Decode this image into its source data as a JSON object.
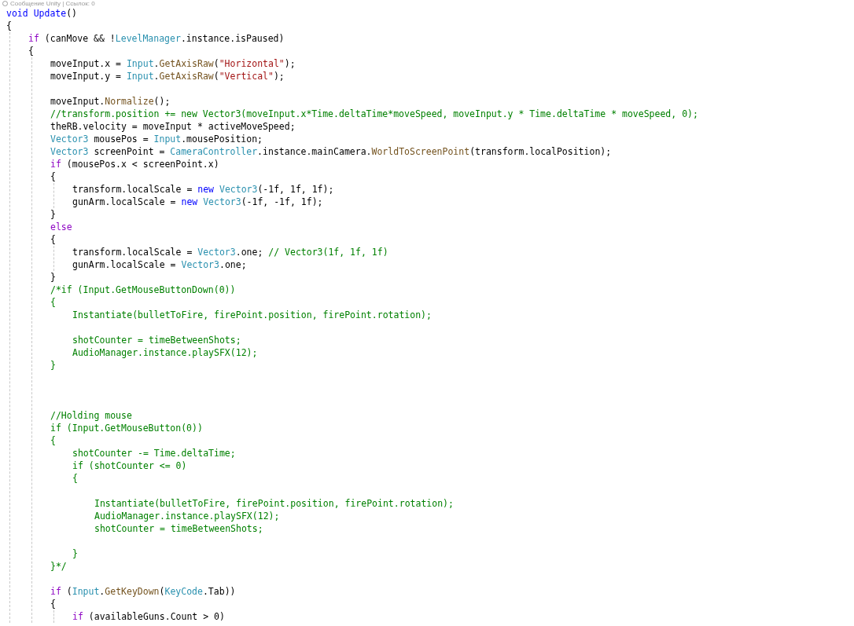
{
  "codelens": "Сообщение Unity | Ссылок: 0",
  "lines": [
    {
      "kind": "code",
      "tokens": [
        {
          "kind": "keyword",
          "text": "void "
        },
        {
          "kind": "keyword",
          "text": "Update"
        },
        {
          "kind": "plain",
          "text": "()"
        }
      ]
    },
    {
      "kind": "code",
      "tokens": [
        {
          "kind": "plain",
          "text": "{"
        }
      ],
      "children": [
        {
          "kind": "code",
          "tokens": [
            {
              "kind": "control",
              "text": "if"
            },
            {
              "kind": "plain",
              "text": " (canMove && !"
            },
            {
              "kind": "type",
              "text": "LevelManager"
            },
            {
              "kind": "plain",
              "text": ".instance.isPaused)"
            }
          ]
        },
        {
          "kind": "code",
          "tokens": [
            {
              "kind": "plain",
              "text": "{"
            }
          ],
          "children": [
            {
              "kind": "code",
              "tokens": [
                {
                  "kind": "plain",
                  "text": "moveInput.x = "
                },
                {
                  "kind": "type",
                  "text": "Input"
                },
                {
                  "kind": "plain",
                  "text": "."
                },
                {
                  "kind": "method",
                  "text": "GetAxisRaw"
                },
                {
                  "kind": "plain",
                  "text": "("
                },
                {
                  "kind": "string",
                  "text": "\"Horizontal\""
                },
                {
                  "kind": "plain",
                  "text": ");"
                }
              ]
            },
            {
              "kind": "code",
              "tokens": [
                {
                  "kind": "plain",
                  "text": "moveInput.y = "
                },
                {
                  "kind": "type",
                  "text": "Input"
                },
                {
                  "kind": "plain",
                  "text": "."
                },
                {
                  "kind": "method",
                  "text": "GetAxisRaw"
                },
                {
                  "kind": "plain",
                  "text": "("
                },
                {
                  "kind": "string",
                  "text": "\"Vertical\""
                },
                {
                  "kind": "plain",
                  "text": ");"
                }
              ]
            },
            {
              "kind": "blank"
            },
            {
              "kind": "code",
              "tokens": [
                {
                  "kind": "plain",
                  "text": "moveInput."
                },
                {
                  "kind": "method",
                  "text": "Normalize"
                },
                {
                  "kind": "plain",
                  "text": "();"
                }
              ]
            },
            {
              "kind": "code",
              "tokens": [
                {
                  "kind": "comment",
                  "text": "//transform.position += new Vector3(moveInput.x*Time.deltaTime*moveSpeed, moveInput.y * Time.deltaTime * moveSpeed, 0);"
                }
              ]
            },
            {
              "kind": "code",
              "tokens": [
                {
                  "kind": "plain",
                  "text": "theRB.velocity = moveInput * activeMoveSpeed;"
                }
              ]
            },
            {
              "kind": "code",
              "tokens": [
                {
                  "kind": "type",
                  "text": "Vector3"
                },
                {
                  "kind": "plain",
                  "text": " mousePos = "
                },
                {
                  "kind": "type",
                  "text": "Input"
                },
                {
                  "kind": "plain",
                  "text": ".mousePosition;"
                }
              ]
            },
            {
              "kind": "code",
              "tokens": [
                {
                  "kind": "type",
                  "text": "Vector3"
                },
                {
                  "kind": "plain",
                  "text": " screenPoint = "
                },
                {
                  "kind": "type",
                  "text": "CameraController"
                },
                {
                  "kind": "plain",
                  "text": ".instance.mainCamera."
                },
                {
                  "kind": "method",
                  "text": "WorldToScreenPoint"
                },
                {
                  "kind": "plain",
                  "text": "(transform.localPosition);"
                }
              ]
            },
            {
              "kind": "code",
              "tokens": [
                {
                  "kind": "control",
                  "text": "if"
                },
                {
                  "kind": "plain",
                  "text": " (mousePos.x < screenPoint.x)"
                }
              ]
            },
            {
              "kind": "code",
              "tokens": [
                {
                  "kind": "plain",
                  "text": "{"
                }
              ],
              "children": [
                {
                  "kind": "code",
                  "tokens": [
                    {
                      "kind": "plain",
                      "text": "transform.localScale = "
                    },
                    {
                      "kind": "keyword",
                      "text": "new "
                    },
                    {
                      "kind": "type",
                      "text": "Vector3"
                    },
                    {
                      "kind": "plain",
                      "text": "(-1f, 1f, 1f);"
                    }
                  ]
                },
                {
                  "kind": "code",
                  "tokens": [
                    {
                      "kind": "plain",
                      "text": "gunArm.localScale = "
                    },
                    {
                      "kind": "keyword",
                      "text": "new "
                    },
                    {
                      "kind": "type",
                      "text": "Vector3"
                    },
                    {
                      "kind": "plain",
                      "text": "(-1f, -1f, 1f);"
                    }
                  ]
                }
              ]
            },
            {
              "kind": "code",
              "tokens": [
                {
                  "kind": "plain",
                  "text": "}"
                }
              ]
            },
            {
              "kind": "code",
              "tokens": [
                {
                  "kind": "control",
                  "text": "else"
                }
              ]
            },
            {
              "kind": "code",
              "tokens": [
                {
                  "kind": "plain",
                  "text": "{"
                }
              ],
              "children": [
                {
                  "kind": "code",
                  "tokens": [
                    {
                      "kind": "plain",
                      "text": "transform.localScale = "
                    },
                    {
                      "kind": "type",
                      "text": "Vector3"
                    },
                    {
                      "kind": "plain",
                      "text": ".one; "
                    },
                    {
                      "kind": "comment",
                      "text": "// Vector3(1f, 1f, 1f)"
                    }
                  ]
                },
                {
                  "kind": "code",
                  "tokens": [
                    {
                      "kind": "plain",
                      "text": "gunArm.localScale = "
                    },
                    {
                      "kind": "type",
                      "text": "Vector3"
                    },
                    {
                      "kind": "plain",
                      "text": ".one;"
                    }
                  ]
                }
              ]
            },
            {
              "kind": "code",
              "tokens": [
                {
                  "kind": "plain",
                  "text": "}"
                }
              ]
            },
            {
              "kind": "code",
              "tokens": [
                {
                  "kind": "comment",
                  "text": "/*if (Input.GetMouseButtonDown(0))"
                }
              ]
            },
            {
              "kind": "code",
              "tokens": [
                {
                  "kind": "comment",
                  "text": "{"
                }
              ],
              "children": [
                {
                  "kind": "code",
                  "tokens": [
                    {
                      "kind": "comment",
                      "text": "Instantiate(bulletToFire, firePoint.position, firePoint.rotation);"
                    }
                  ]
                },
                {
                  "kind": "blank"
                },
                {
                  "kind": "code",
                  "tokens": [
                    {
                      "kind": "comment",
                      "text": "shotCounter = timeBetweenShots;"
                    }
                  ]
                },
                {
                  "kind": "code",
                  "tokens": [
                    {
                      "kind": "comment",
                      "text": "AudioManager.instance.playSFX(12);"
                    }
                  ]
                }
              ]
            },
            {
              "kind": "code",
              "tokens": [
                {
                  "kind": "comment",
                  "text": "}"
                }
              ]
            },
            {
              "kind": "blank"
            },
            {
              "kind": "blank"
            },
            {
              "kind": "blank"
            },
            {
              "kind": "code",
              "tokens": [
                {
                  "kind": "comment",
                  "text": "//Holding mouse"
                }
              ]
            },
            {
              "kind": "code",
              "tokens": [
                {
                  "kind": "comment",
                  "text": "if (Input.GetMouseButton(0))"
                }
              ]
            },
            {
              "kind": "code",
              "tokens": [
                {
                  "kind": "comment",
                  "text": "{"
                }
              ],
              "children": [
                {
                  "kind": "code",
                  "tokens": [
                    {
                      "kind": "comment",
                      "text": "shotCounter -= Time.deltaTime;"
                    }
                  ]
                },
                {
                  "kind": "code",
                  "tokens": [
                    {
                      "kind": "comment",
                      "text": "if (shotCounter <= 0)"
                    }
                  ]
                },
                {
                  "kind": "code",
                  "tokens": [
                    {
                      "kind": "comment",
                      "text": "{"
                    }
                  ],
                  "children": [
                    {
                      "kind": "blank"
                    },
                    {
                      "kind": "code",
                      "tokens": [
                        {
                          "kind": "comment",
                          "text": "Instantiate(bulletToFire, firePoint.position, firePoint.rotation);"
                        }
                      ]
                    },
                    {
                      "kind": "code",
                      "tokens": [
                        {
                          "kind": "comment",
                          "text": "AudioManager.instance.playSFX(12);"
                        }
                      ]
                    },
                    {
                      "kind": "code",
                      "tokens": [
                        {
                          "kind": "comment",
                          "text": "shotCounter = timeBetweenShots;"
                        }
                      ]
                    },
                    {
                      "kind": "blank"
                    }
                  ]
                },
                {
                  "kind": "code",
                  "tokens": [
                    {
                      "kind": "comment",
                      "text": "}"
                    }
                  ]
                }
              ]
            },
            {
              "kind": "code",
              "tokens": [
                {
                  "kind": "comment",
                  "text": "}*/"
                }
              ]
            },
            {
              "kind": "blank"
            },
            {
              "kind": "code",
              "tokens": [
                {
                  "kind": "control",
                  "text": "if"
                },
                {
                  "kind": "plain",
                  "text": " ("
                },
                {
                  "kind": "type",
                  "text": "Input"
                },
                {
                  "kind": "plain",
                  "text": "."
                },
                {
                  "kind": "method",
                  "text": "GetKeyDown"
                },
                {
                  "kind": "plain",
                  "text": "("
                },
                {
                  "kind": "type",
                  "text": "KeyCode"
                },
                {
                  "kind": "plain",
                  "text": ".Tab))"
                }
              ]
            },
            {
              "kind": "code",
              "tokens": [
                {
                  "kind": "plain",
                  "text": "{"
                }
              ],
              "children": [
                {
                  "kind": "code",
                  "tokens": [
                    {
                      "kind": "control",
                      "text": "if"
                    },
                    {
                      "kind": "plain",
                      "text": " (availableGuns.Count > 0)"
                    }
                  ]
                }
              ]
            }
          ]
        }
      ]
    }
  ]
}
